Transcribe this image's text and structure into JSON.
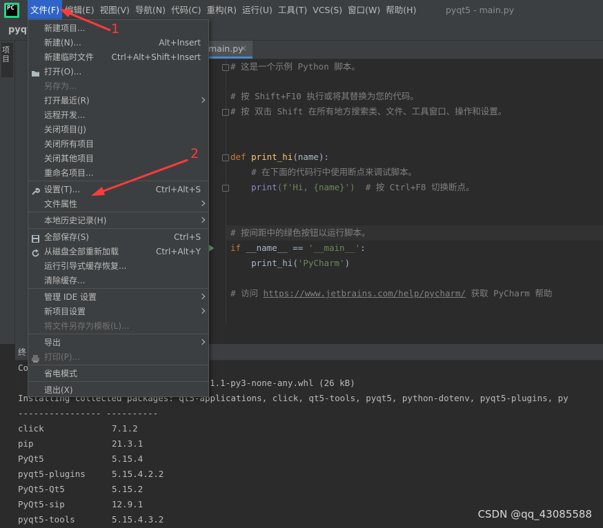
{
  "window_title": "pyqt5 - main.py",
  "menubar": [
    "文件(F)",
    "编辑(E)",
    "视图(V)",
    "导航(N)",
    "代码(C)",
    "重构(R)",
    "运行(U)",
    "工具(T)",
    "VCS(S)",
    "窗口(W)",
    "帮助(H)"
  ],
  "logo_text": "PC",
  "nav_project": "pyqt",
  "sidebar_tab": "项目",
  "tab": {
    "label": "main.py",
    "close": "×"
  },
  "code": {
    "l1": "# 这是一个示例 Python 脚本。",
    "l2": "# 按 Shift+F10 执行或将其替换为您的代码。",
    "l3": "# 按 双击 Shift 在所有地方搜索类、文件、工具窗口、操作和设置。",
    "def_kw": "def ",
    "def_name": "print_hi",
    "def_rest": "(name):",
    "l5": "    # 在下面的代码行中使用断点来调试脚本。",
    "print_builtin": "print",
    "print_args": "(f'Hi, {name}')",
    "print_cmt": "  # 按 Ctrl+F8 切换断点。",
    "l7": "# 按间距中的绿色按钮以运行脚本。",
    "if_kw": "if ",
    "if_name": "__name__ == ",
    "if_str": "'__main__'",
    "if_end": ":",
    "call_fn": "print_hi",
    "call_open": "(",
    "call_str": "'PyCharm'",
    "call_close": ")",
    "visit_pre": "# 访问 ",
    "visit_url": "https://www.jetbrains.com/help/pycharm/",
    "visit_post": " 获取 PyCharm 帮助"
  },
  "terminal_tab": "终",
  "terminal": {
    "line1": "Co",
    "line2_tail": "1.1-py3-none-any.whl (26 kB)",
    "line3": "Installing collected packages: qt5-applications, click, qt5-tools, pyqt5, python-dotenv, pyqt5-plugins, py",
    "sep": "---------------- ----------",
    "packages": [
      {
        "name": "click",
        "version": "7.1.2"
      },
      {
        "name": "pip",
        "version": "21.3.1"
      },
      {
        "name": "PyQt5",
        "version": "5.15.4"
      },
      {
        "name": "pyqt5-plugins",
        "version": "5.15.4.2.2"
      },
      {
        "name": "PyQt5-Qt5",
        "version": "5.15.2"
      },
      {
        "name": "PyQt5-sip",
        "version": "12.9.1"
      },
      {
        "name": "pyqt5-tools",
        "version": "5.15.4.3.2"
      }
    ]
  },
  "file_menu": [
    {
      "label": "新建项目...",
      "shortcut": "",
      "disabled": false
    },
    {
      "label": "新建(N)...",
      "shortcut": "Alt+Insert",
      "disabled": false
    },
    {
      "label": "新建临时文件",
      "shortcut": "Ctrl+Alt+Shift+Insert",
      "disabled": false
    },
    {
      "label": "打开(O)...",
      "shortcut": "",
      "disabled": false
    },
    {
      "label": "另存为...",
      "shortcut": "",
      "disabled": true
    },
    {
      "label": "打开最近(R)",
      "shortcut": "",
      "disabled": false
    },
    {
      "label": "远程开发...",
      "shortcut": "",
      "disabled": false
    },
    {
      "label": "关闭项目(J)",
      "shortcut": "",
      "disabled": false
    },
    {
      "label": "关闭所有项目",
      "shortcut": "",
      "disabled": false
    },
    {
      "label": "关闭其他项目",
      "shortcut": "",
      "disabled": false
    },
    {
      "label": "重命名项目...",
      "shortcut": "",
      "disabled": false
    },
    {
      "label": "设置(T)...",
      "shortcut": "Ctrl+Alt+S",
      "disabled": false
    },
    {
      "label": "文件属性",
      "shortcut": "",
      "disabled": false
    },
    {
      "label": "本地历史记录(H)",
      "shortcut": "",
      "disabled": false
    },
    {
      "label": "全部保存(S)",
      "shortcut": "Ctrl+S",
      "disabled": false
    },
    {
      "label": "从磁盘全部重新加载",
      "shortcut": "Ctrl+Alt+Y",
      "disabled": false
    },
    {
      "label": "运行引导式缓存恢复...",
      "shortcut": "",
      "disabled": false
    },
    {
      "label": "清除缓存...",
      "shortcut": "",
      "disabled": false
    },
    {
      "label": "管理 IDE 设置",
      "shortcut": "",
      "disabled": false
    },
    {
      "label": "新项目设置",
      "shortcut": "",
      "disabled": false
    },
    {
      "label": "将文件另存为模板(L)...",
      "shortcut": "",
      "disabled": true
    },
    {
      "label": "导出",
      "shortcut": "",
      "disabled": false
    },
    {
      "label": "打印(P)...",
      "shortcut": "",
      "disabled": true
    },
    {
      "label": "省电模式",
      "shortcut": "",
      "disabled": false
    },
    {
      "label": "退出(X)",
      "shortcut": "",
      "disabled": false
    }
  ],
  "annotations": {
    "one": "1",
    "two": "2"
  },
  "watermark": "CSDN @qq_43085588",
  "colors": {
    "accent": "#2f65ca",
    "annotation": "#ff3b3b",
    "pycharm_green": "#21d789"
  }
}
